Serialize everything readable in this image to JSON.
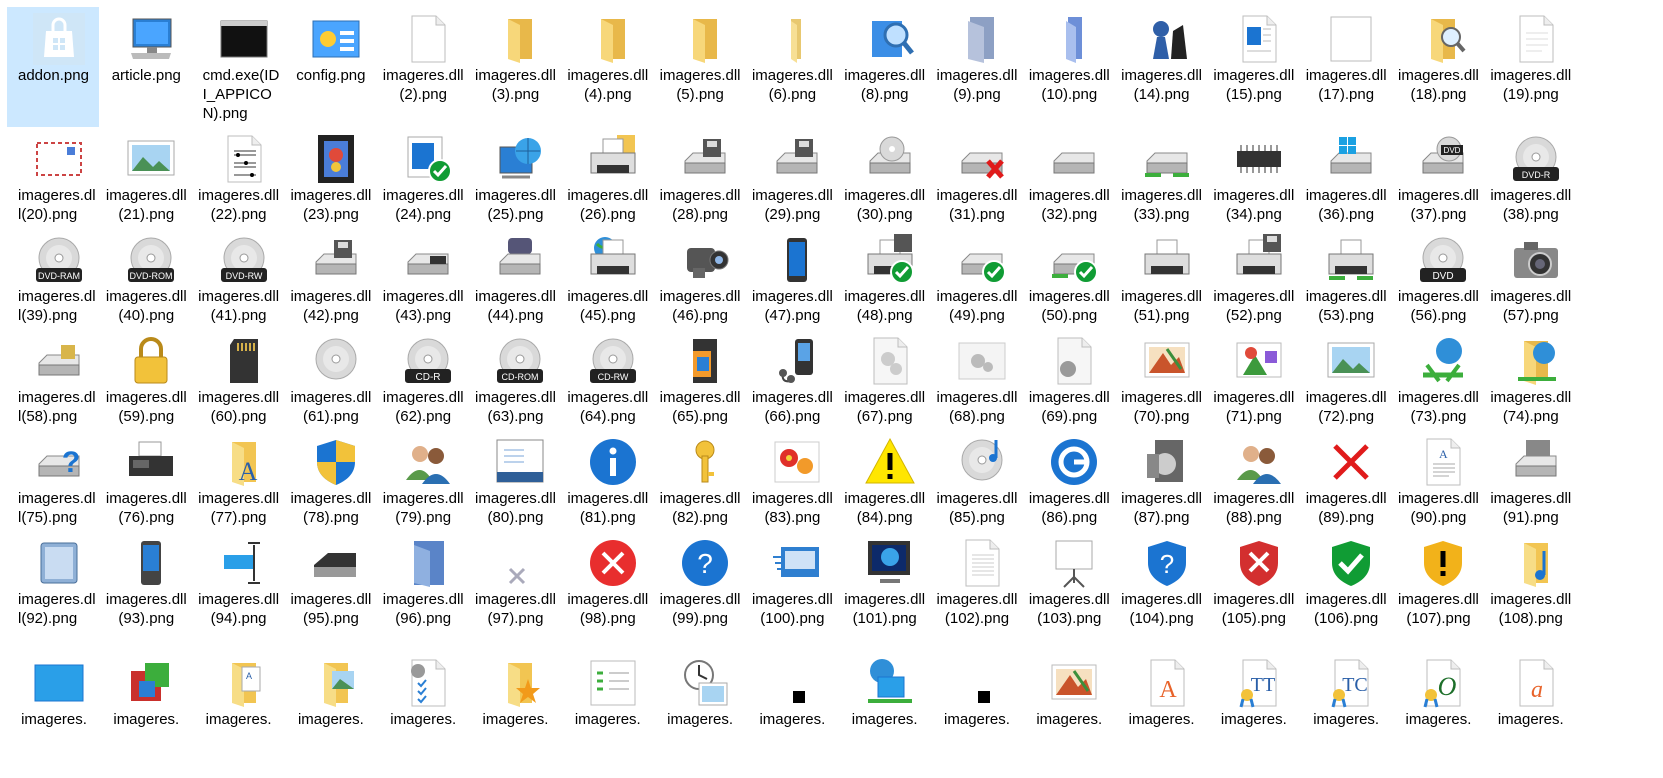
{
  "files": [
    {
      "name": "addon.png",
      "icon": "store-bag-icon",
      "selected": true
    },
    {
      "name": "article.png",
      "icon": "computer-monitor-icon"
    },
    {
      "name": "cmd.exe(IDI_APPICON).png",
      "icon": "console-window-icon"
    },
    {
      "name": "config.png",
      "icon": "control-panel-icon"
    },
    {
      "name": "imageres.dll(2).png",
      "icon": "blank-document-icon"
    },
    {
      "name": "imageres.dll(3).png",
      "icon": "folder-icon"
    },
    {
      "name": "imageres.dll(4).png",
      "icon": "folder-icon"
    },
    {
      "name": "imageres.dll(5).png",
      "icon": "folder-icon"
    },
    {
      "name": "imageres.dll(6).png",
      "icon": "folder-narrow-icon"
    },
    {
      "name": "imageres.dll(8).png",
      "icon": "search-cube-icon"
    },
    {
      "name": "imageres.dll(9).png",
      "icon": "gray-folder-icon"
    },
    {
      "name": "imageres.dll(10).png",
      "icon": "blue-folder-icon"
    },
    {
      "name": "imageres.dll(14).png",
      "icon": "chess-pieces-icon"
    },
    {
      "name": "imageres.dll(15).png",
      "icon": "web-page-icon"
    },
    {
      "name": "imageres.dll(17).png",
      "icon": "blank-page-icon"
    },
    {
      "name": "imageres.dll(18).png",
      "icon": "folder-search-icon"
    },
    {
      "name": "imageres.dll(19).png",
      "icon": "text-document-icon"
    },
    {
      "name": "imageres.dll(20).png",
      "icon": "envelope-icon"
    },
    {
      "name": "imageres.dll(21).png",
      "icon": "landscape-picture-icon"
    },
    {
      "name": "imageres.dll(22).png",
      "icon": "sheet-music-icon"
    },
    {
      "name": "imageres.dll(23).png",
      "icon": "film-strip-icon"
    },
    {
      "name": "imageres.dll(24).png",
      "icon": "app-check-icon"
    },
    {
      "name": "imageres.dll(25).png",
      "icon": "network-globe-icon"
    },
    {
      "name": "imageres.dll(26).png",
      "icon": "printer-folder-icon"
    },
    {
      "name": "imageres.dll(28).png",
      "icon": "floppy-drive-icon"
    },
    {
      "name": "imageres.dll(29).png",
      "icon": "floppy-drive-icon"
    },
    {
      "name": "imageres.dll(30).png",
      "icon": "cd-drive-icon"
    },
    {
      "name": "imageres.dll(31).png",
      "icon": "drive-error-icon"
    },
    {
      "name": "imageres.dll(32).png",
      "icon": "hard-drive-icon"
    },
    {
      "name": "imageres.dll(33).png",
      "icon": "network-drive-icon"
    },
    {
      "name": "imageres.dll(34).png",
      "icon": "memory-chip-icon"
    },
    {
      "name": "imageres.dll(36).png",
      "icon": "windows-drive-icon"
    },
    {
      "name": "imageres.dll(37).png",
      "icon": "dvd-drive-icon"
    },
    {
      "name": "imageres.dll(38).png",
      "icon": "dvd-r-disc-icon"
    },
    {
      "name": "imageres.dll(39).png",
      "icon": "dvd-ram-disc-icon"
    },
    {
      "name": "imageres.dll(40).png",
      "icon": "dvd-rom-disc-icon"
    },
    {
      "name": "imageres.dll(41).png",
      "icon": "dvd-rw-disc-icon"
    },
    {
      "name": "imageres.dll(42).png",
      "icon": "floppy-drive-icon"
    },
    {
      "name": "imageres.dll(43).png",
      "icon": "tape-drive-icon"
    },
    {
      "name": "imageres.dll(44).png",
      "icon": "removable-drive-icon"
    },
    {
      "name": "imageres.dll(45).png",
      "icon": "network-printer-icon"
    },
    {
      "name": "imageres.dll(46).png",
      "icon": "video-camera-icon"
    },
    {
      "name": "imageres.dll(47).png",
      "icon": "mobile-phone-icon"
    },
    {
      "name": "imageres.dll(48).png",
      "icon": "printer-check-icon"
    },
    {
      "name": "imageres.dll(49).png",
      "icon": "drive-check-icon"
    },
    {
      "name": "imageres.dll(50).png",
      "icon": "network-check-icon"
    },
    {
      "name": "imageres.dll(51).png",
      "icon": "printer-icon"
    },
    {
      "name": "imageres.dll(52).png",
      "icon": "printer-floppy-icon"
    },
    {
      "name": "imageres.dll(53).png",
      "icon": "network-printer-green-icon"
    },
    {
      "name": "imageres.dll(56).png",
      "icon": "dvd-disc-icon"
    },
    {
      "name": "imageres.dll(57).png",
      "icon": "camera-icon"
    },
    {
      "name": "imageres.dll(58).png",
      "icon": "card-reader-drive-icon"
    },
    {
      "name": "imageres.dll(59).png",
      "icon": "padlock-icon"
    },
    {
      "name": "imageres.dll(60).png",
      "icon": "sd-card-icon"
    },
    {
      "name": "imageres.dll(61).png",
      "icon": "disc-icon"
    },
    {
      "name": "imageres.dll(62).png",
      "icon": "cd-r-disc-icon"
    },
    {
      "name": "imageres.dll(63).png",
      "icon": "cd-rom-disc-icon"
    },
    {
      "name": "imageres.dll(64).png",
      "icon": "cd-rw-disc-icon"
    },
    {
      "name": "imageres.dll(65).png",
      "icon": "memory-card-icon"
    },
    {
      "name": "imageres.dll(66).png",
      "icon": "media-player-icon"
    },
    {
      "name": "imageres.dll(67).png",
      "icon": "gears-document-icon"
    },
    {
      "name": "imageres.dll(68).png",
      "icon": "gears-window-icon"
    },
    {
      "name": "imageres.dll(69).png",
      "icon": "gear-document-icon"
    },
    {
      "name": "imageres.dll(70).png",
      "icon": "painting-icon"
    },
    {
      "name": "imageres.dll(71).png",
      "icon": "shapes-picture-icon"
    },
    {
      "name": "imageres.dll(72).png",
      "icon": "landscape-picture-icon"
    },
    {
      "name": "imageres.dll(73).png",
      "icon": "network-globe-green-icon"
    },
    {
      "name": "imageres.dll(74).png",
      "icon": "folder-globe-icon"
    },
    {
      "name": "imageres.dll(75).png",
      "icon": "drive-question-icon"
    },
    {
      "name": "imageres.dll(76).png",
      "icon": "fax-icon"
    },
    {
      "name": "imageres.dll(77).png",
      "icon": "folder-font-icon"
    },
    {
      "name": "imageres.dll(78).png",
      "icon": "shield-icon"
    },
    {
      "name": "imageres.dll(79).png",
      "icon": "users-icon"
    },
    {
      "name": "imageres.dll(80).png",
      "icon": "dialog-window-icon"
    },
    {
      "name": "imageres.dll(81).png",
      "icon": "info-icon"
    },
    {
      "name": "imageres.dll(82).png",
      "icon": "key-icon"
    },
    {
      "name": "imageres.dll(83).png",
      "icon": "flowers-icon"
    },
    {
      "name": "imageres.dll(84).png",
      "icon": "warning-icon"
    },
    {
      "name": "imageres.dll(85).png",
      "icon": "music-disc-icon"
    },
    {
      "name": "imageres.dll(86).png",
      "icon": "power-clock-icon"
    },
    {
      "name": "imageres.dll(87).png",
      "icon": "media-case-icon"
    },
    {
      "name": "imageres.dll(88).png",
      "icon": "users-icon"
    },
    {
      "name": "imageres.dll(89).png",
      "icon": "red-x-icon"
    },
    {
      "name": "imageres.dll(90).png",
      "icon": "font-document-icon"
    },
    {
      "name": "imageres.dll(91).png",
      "icon": "server-drive-icon"
    },
    {
      "name": "imageres.dll(92).png",
      "icon": "external-drive-icon"
    },
    {
      "name": "imageres.dll(93).png",
      "icon": "pda-icon"
    },
    {
      "name": "imageres.dll(94).png",
      "icon": "text-cursor-icon"
    },
    {
      "name": "imageres.dll(95).png",
      "icon": "scanner-icon"
    },
    {
      "name": "imageres.dll(96).png",
      "icon": "blue-folder-box-icon"
    },
    {
      "name": "imageres.dll(97).png",
      "icon": "small-gray-x-icon"
    },
    {
      "name": "imageres.dll(98).png",
      "icon": "error-circle-icon"
    },
    {
      "name": "imageres.dll(99).png",
      "icon": "help-circle-icon"
    },
    {
      "name": "imageres.dll(100).png",
      "icon": "speed-card-icon"
    },
    {
      "name": "imageres.dll(101).png",
      "icon": "monitor-planet-icon"
    },
    {
      "name": "imageres.dll(102).png",
      "icon": "lined-document-icon"
    },
    {
      "name": "imageres.dll(103).png",
      "icon": "projector-screen-icon"
    },
    {
      "name": "imageres.dll(104).png",
      "icon": "shield-question-icon"
    },
    {
      "name": "imageres.dll(105).png",
      "icon": "shield-error-icon"
    },
    {
      "name": "imageres.dll(106).png",
      "icon": "shield-check-icon"
    },
    {
      "name": "imageres.dll(107).png",
      "icon": "shield-warning-icon"
    },
    {
      "name": "imageres.dll(108).png",
      "icon": "folder-music-icon"
    },
    {
      "name": "imageres.",
      "icon": "blue-window-icon"
    },
    {
      "name": "imageres.",
      "icon": "colored-blocks-icon"
    },
    {
      "name": "imageres.",
      "icon": "folder-document-icon"
    },
    {
      "name": "imageres.",
      "icon": "folder-picture-icon"
    },
    {
      "name": "imageres.",
      "icon": "settings-checklist-icon"
    },
    {
      "name": "imageres.",
      "icon": "folder-star-icon"
    },
    {
      "name": "imageres.",
      "icon": "list-arrows-icon"
    },
    {
      "name": "imageres.",
      "icon": "clock-picture-icon"
    },
    {
      "name": "imageres.",
      "icon": "small-square-icon"
    },
    {
      "name": "imageres.",
      "icon": "network-monitors-icon"
    },
    {
      "name": "imageres.",
      "icon": "small-square-icon"
    },
    {
      "name": "imageres.",
      "icon": "painting-icon"
    },
    {
      "name": "imageres.",
      "icon": "font-a-icon"
    },
    {
      "name": "imageres.",
      "icon": "font-tt-icon"
    },
    {
      "name": "imageres.",
      "icon": "font-tc-icon"
    },
    {
      "name": "imageres.",
      "icon": "font-o-icon"
    },
    {
      "name": "imageres.",
      "icon": "font-a-italic-icon"
    }
  ]
}
